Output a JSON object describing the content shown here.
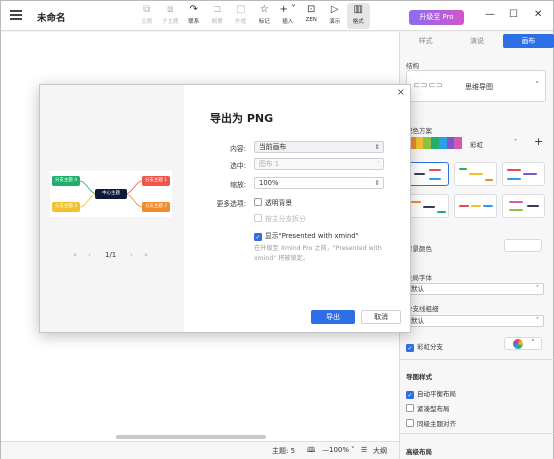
{
  "app": {
    "doc_title": "未命名",
    "toolbar": [
      {
        "label": "主题",
        "icon": "topic-icon",
        "glyph": "⧉",
        "disabled": true
      },
      {
        "label": "子主题",
        "icon": "subtopic-icon",
        "glyph": "⧈",
        "disabled": true
      },
      {
        "label": "联系",
        "icon": "relationship-icon",
        "glyph": "↷",
        "disabled": false
      },
      {
        "label": "概要",
        "icon": "summary-icon",
        "glyph": "⊐",
        "disabled": true
      },
      {
        "label": "外框",
        "icon": "boundary-icon",
        "glyph": "▢",
        "disabled": true
      },
      {
        "label": "标记",
        "icon": "marker-icon",
        "glyph": "☆",
        "disabled": false
      },
      {
        "label": "插入",
        "icon": "insert-icon",
        "glyph": "+ ˅",
        "disabled": false
      },
      {
        "label": "ZEN",
        "icon": "zen-icon",
        "glyph": "⊡",
        "disabled": false
      },
      {
        "label": "演示",
        "icon": "present-icon",
        "glyph": "▷",
        "disabled": false
      },
      {
        "label": "格式",
        "icon": "format-icon",
        "glyph": "▥",
        "disabled": false,
        "active": true
      }
    ],
    "pro_button": "升级至 Pro"
  },
  "status": {
    "topics": "主题: 5",
    "zoom": "100%",
    "outline": "大纲"
  },
  "panel": {
    "tabs": [
      "样式",
      "画布",
      "画布"
    ],
    "tab_labels": {
      "style": "样式",
      "outliner": "演说",
      "canvas": "画布"
    },
    "structure_label": "结构",
    "structure_value": "思维导图",
    "color_scheme_label": "配色方案",
    "color_scheme_value": "彩虹",
    "bg_color_label": "背景颜色",
    "font_label": "全局字体",
    "font_value": "默认",
    "line_label": "分支线粗细",
    "line_value": "默认",
    "rainbow_label": "彩虹分支",
    "map_style_label": "导图样式",
    "opt_auto_balance": "自动平衡布局",
    "opt_compact": "紧凑型布局",
    "opt_align": "同级主题对齐",
    "advanced_label": "高级布局"
  },
  "dialog": {
    "title": "导出为 PNG",
    "content_label": "内容:",
    "content_value": "当前画布",
    "selection_label": "选中:",
    "selection_value": "图布 1",
    "scale_label": "缩放:",
    "scale_value": "100%",
    "more_label": "更多选项:",
    "opt_transparent": "透明背景",
    "opt_branch": "按主分支拆分",
    "opt_watermark": "显示\"Presented with xmind\"",
    "note": "在升级至 Xmind Pro 之前，\"Presented with xmind\" 将被锁定。",
    "export_button": "导出",
    "cancel_button": "取消",
    "pager": "1/1",
    "preview": {
      "center": "中心主题",
      "branches": [
        "分支主题 1",
        "分支主题 2",
        "分支主题 3",
        "分支主题 4"
      ],
      "colors": {
        "center": "#0f1a3a",
        "b1": "#f0554a",
        "b2": "#f08a2d",
        "b3": "#f2c12e",
        "b4": "#1fae6b"
      }
    }
  }
}
